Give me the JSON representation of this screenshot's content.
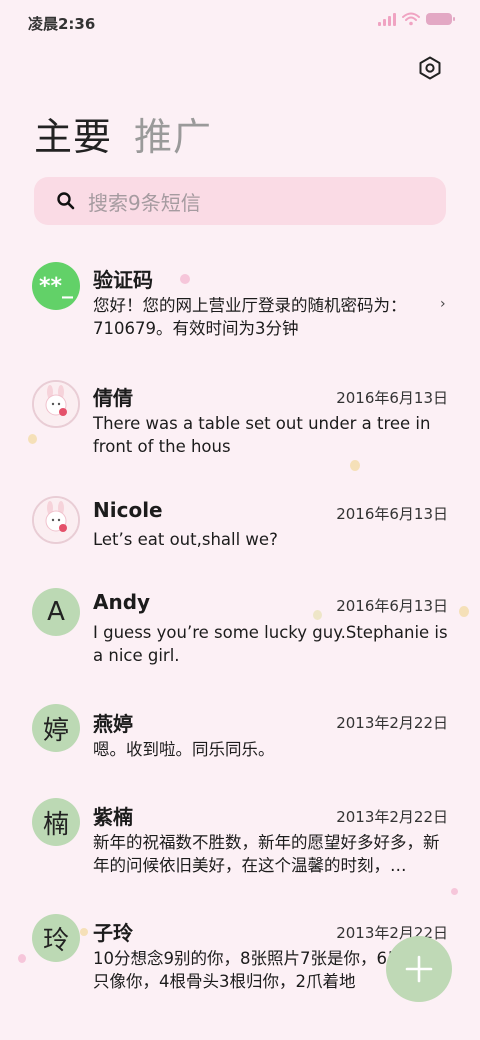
{
  "status_bar": {
    "time": "凌晨2:36",
    "icons": [
      "signal-icon",
      "wifi-icon",
      "battery-icon"
    ]
  },
  "header": {
    "settings_icon": "settings-icon"
  },
  "tabs": [
    {
      "label": "主要",
      "active": true
    },
    {
      "label": "推广",
      "active": false
    }
  ],
  "search": {
    "placeholder": "搜索9条短信",
    "icon": "search-icon"
  },
  "conversations": [
    {
      "name": "验证码",
      "avatar_text": "**_",
      "avatar_type": "green",
      "date": "",
      "preview": "您好！您的网上营业厅登录的随机密码为：710679。有效时间为3分钟"
    },
    {
      "name": "倩倩",
      "avatar_type": "photo",
      "date": "2016年6月13日",
      "preview": "There was a table set out under a tree in front of the hous"
    },
    {
      "name": "Nicole",
      "avatar_type": "photo",
      "date": "2016年6月13日",
      "preview": "Let’s eat out,shall we?"
    },
    {
      "name": "Andy",
      "avatar_text": "A",
      "avatar_type": "letter",
      "date": "2016年6月13日",
      "preview": "I guess you’re some lucky guy.Stephanie is a nice girl."
    },
    {
      "name": "燕婷",
      "avatar_text": "婷",
      "avatar_type": "letter",
      "date": "2013年2月22日",
      "preview": "嗯。收到啦。同乐同乐。"
    },
    {
      "name": "紫楠",
      "avatar_text": "楠",
      "avatar_type": "letter",
      "date": "2013年2月22日",
      "preview": "新年的祝福数不胜数，新年的愿望好多好多，新年的问候依旧美好，在这个温馨的时刻，…"
    },
    {
      "name": "子玲",
      "avatar_text": "玲",
      "avatar_type": "letter",
      "date": "2013年2月22日",
      "preview": "10分想念9别的你，8张照片7张是你，6只小狗5只像你，4根骨头3根归你，2爪着地"
    }
  ],
  "fab": {
    "icon": "plus-icon"
  },
  "colors": {
    "background": "#fcf0f5",
    "search_bg": "#fadbe5",
    "accent_green": "#62d168",
    "avatar_letter_bg": "#bcd9b4",
    "fab_bg": "#bfd9b6"
  }
}
